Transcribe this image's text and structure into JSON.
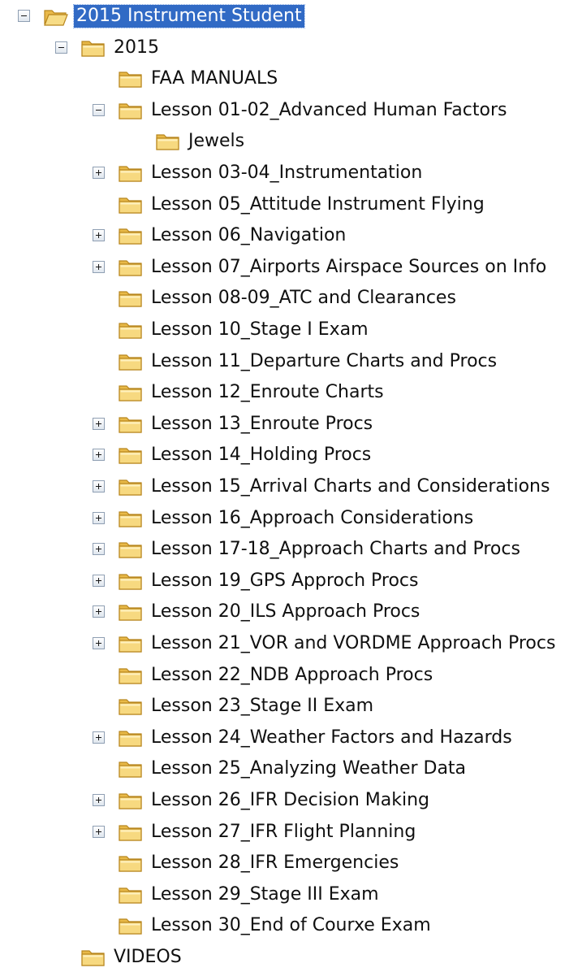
{
  "tree": {
    "nodes": [
      {
        "label": "2015 Instrument Student",
        "level": 0,
        "toggle": "expanded",
        "open_folder": true,
        "selected": true
      },
      {
        "label": "2015",
        "level": 1,
        "toggle": "expanded",
        "open_folder": false,
        "selected": false
      },
      {
        "label": "FAA MANUALS",
        "level": 2,
        "toggle": "none",
        "open_folder": false,
        "selected": false
      },
      {
        "label": "Lesson 01-02_Advanced Human Factors",
        "level": 2,
        "toggle": "expanded",
        "open_folder": false,
        "selected": false
      },
      {
        "label": "Jewels",
        "level": 3,
        "toggle": "none",
        "open_folder": false,
        "selected": false
      },
      {
        "label": "Lesson 03-04_Instrumentation",
        "level": 2,
        "toggle": "collapsed",
        "open_folder": false,
        "selected": false
      },
      {
        "label": "Lesson 05_Attitude Instrument Flying",
        "level": 2,
        "toggle": "none",
        "open_folder": false,
        "selected": false
      },
      {
        "label": "Lesson 06_Navigation",
        "level": 2,
        "toggle": "collapsed",
        "open_folder": false,
        "selected": false
      },
      {
        "label": "Lesson 07_Airports Airspace Sources on Info",
        "level": 2,
        "toggle": "collapsed",
        "open_folder": false,
        "selected": false
      },
      {
        "label": "Lesson 08-09_ATC and Clearances",
        "level": 2,
        "toggle": "none",
        "open_folder": false,
        "selected": false
      },
      {
        "label": "Lesson 10_Stage I Exam",
        "level": 2,
        "toggle": "none",
        "open_folder": false,
        "selected": false
      },
      {
        "label": "Lesson 11_Departure Charts and Procs",
        "level": 2,
        "toggle": "none",
        "open_folder": false,
        "selected": false
      },
      {
        "label": "Lesson 12_Enroute Charts",
        "level": 2,
        "toggle": "none",
        "open_folder": false,
        "selected": false
      },
      {
        "label": "Lesson 13_Enroute Procs",
        "level": 2,
        "toggle": "collapsed",
        "open_folder": false,
        "selected": false
      },
      {
        "label": "Lesson 14_Holding Procs",
        "level": 2,
        "toggle": "collapsed",
        "open_folder": false,
        "selected": false
      },
      {
        "label": "Lesson 15_Arrival Charts and Considerations",
        "level": 2,
        "toggle": "collapsed",
        "open_folder": false,
        "selected": false
      },
      {
        "label": "Lesson 16_Approach Considerations",
        "level": 2,
        "toggle": "collapsed",
        "open_folder": false,
        "selected": false
      },
      {
        "label": "Lesson 17-18_Approach Charts and Procs",
        "level": 2,
        "toggle": "collapsed",
        "open_folder": false,
        "selected": false
      },
      {
        "label": "Lesson 19_GPS Approch Procs",
        "level": 2,
        "toggle": "collapsed",
        "open_folder": false,
        "selected": false
      },
      {
        "label": "Lesson 20_ILS Approach Procs",
        "level": 2,
        "toggle": "collapsed",
        "open_folder": false,
        "selected": false
      },
      {
        "label": "Lesson 21_VOR and VORDME Approach Procs",
        "level": 2,
        "toggle": "collapsed",
        "open_folder": false,
        "selected": false
      },
      {
        "label": "Lesson 22_NDB Approach Procs",
        "level": 2,
        "toggle": "none",
        "open_folder": false,
        "selected": false
      },
      {
        "label": "Lesson 23_Stage II Exam",
        "level": 2,
        "toggle": "none",
        "open_folder": false,
        "selected": false
      },
      {
        "label": "Lesson 24_Weather Factors and Hazards",
        "level": 2,
        "toggle": "collapsed",
        "open_folder": false,
        "selected": false
      },
      {
        "label": "Lesson 25_Analyzing Weather Data",
        "level": 2,
        "toggle": "none",
        "open_folder": false,
        "selected": false
      },
      {
        "label": "Lesson 26_IFR Decision Making",
        "level": 2,
        "toggle": "collapsed",
        "open_folder": false,
        "selected": false
      },
      {
        "label": "Lesson 27_IFR Flight Planning",
        "level": 2,
        "toggle": "collapsed",
        "open_folder": false,
        "selected": false
      },
      {
        "label": "Lesson 28_IFR Emergencies",
        "level": 2,
        "toggle": "none",
        "open_folder": false,
        "selected": false
      },
      {
        "label": "Lesson 29_Stage III Exam",
        "level": 2,
        "toggle": "none",
        "open_folder": false,
        "selected": false
      },
      {
        "label": "Lesson 30_End of Courxe Exam",
        "level": 2,
        "toggle": "none",
        "open_folder": false,
        "selected": false
      },
      {
        "label": "VIDEOS",
        "level": 1,
        "toggle": "none",
        "open_folder": false,
        "selected": false
      }
    ]
  },
  "colors": {
    "selection_bg": "#316ac5",
    "selection_text": "#ffffff",
    "folder_fill": "#f5d477",
    "folder_dark": "#c89a2c"
  },
  "icons": {
    "folder": "folder-icon",
    "folder_open": "folder-open-icon",
    "expanded_toggle": "minus-box-icon",
    "collapsed_toggle": "plus-box-icon"
  }
}
